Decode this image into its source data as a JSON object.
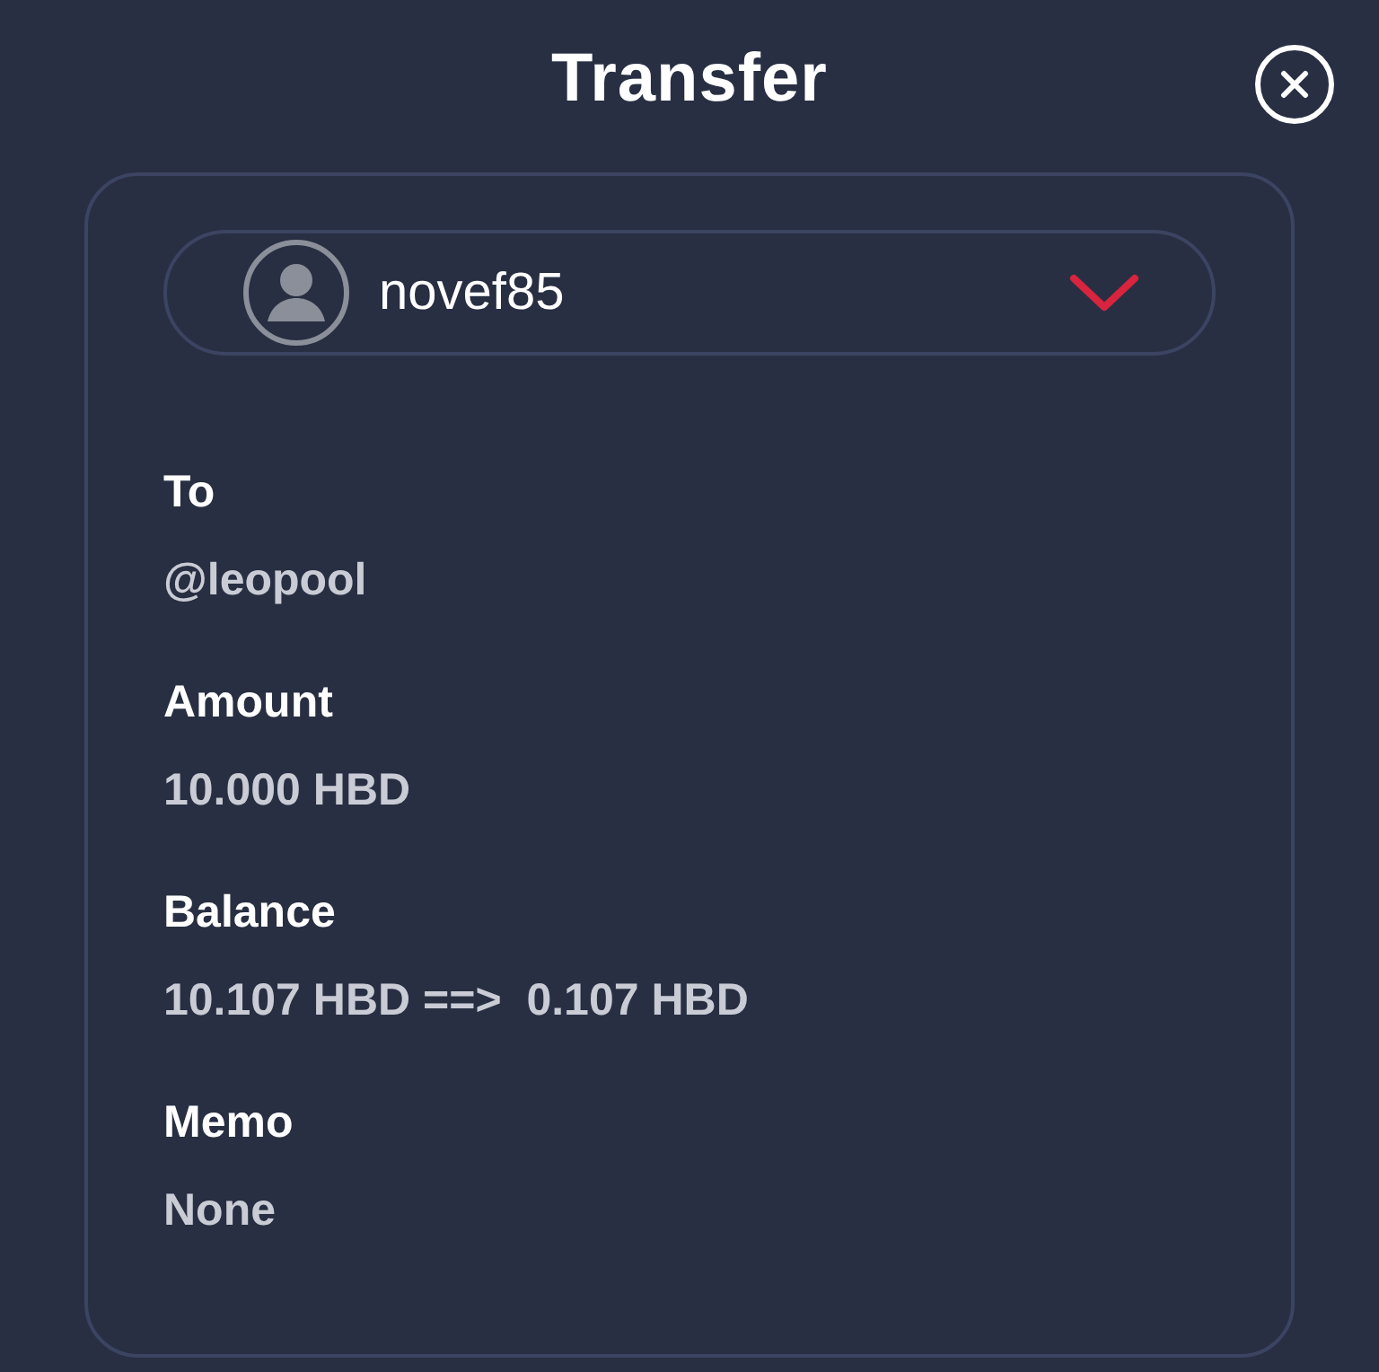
{
  "title": "Transfer",
  "account": {
    "name": "novef85"
  },
  "fields": [
    {
      "label": "To",
      "value": "@leopool"
    },
    {
      "label": "Amount",
      "value": "10.000 HBD"
    },
    {
      "label": "Balance",
      "value": "10.107 HBD ==>  0.107 HBD"
    },
    {
      "label": "Memo",
      "value": "None"
    }
  ]
}
